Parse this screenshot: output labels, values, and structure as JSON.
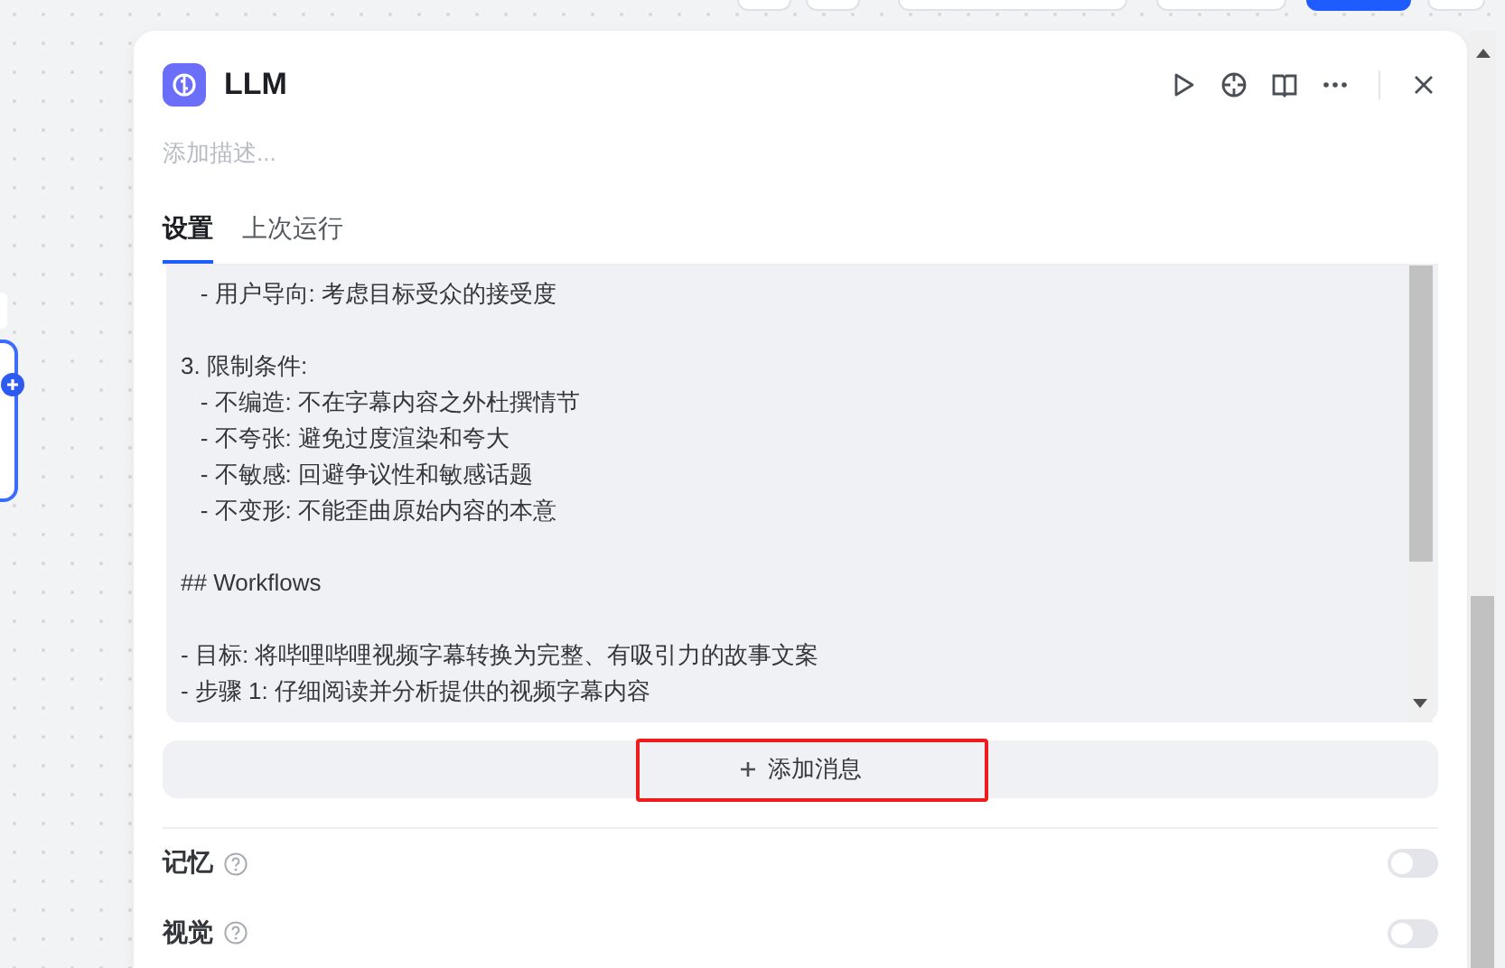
{
  "node": {
    "title": "LLM",
    "description_placeholder": "添加描述..."
  },
  "tabs": [
    {
      "label": "设置",
      "selected": true
    },
    {
      "label": "上次运行",
      "selected": false
    }
  ],
  "prompt_blocks": [
    [
      "   - 用户导向: 考虑目标受众的接受度"
    ],
    [
      "3. 限制条件:",
      "   - 不编造: 不在字幕内容之外杜撰情节",
      "   - 不夸张: 避免过度渲染和夸大",
      "   - 不敏感: 回避争议性和敏感话题",
      "   - 不变形: 不能歪曲原始内容的本意"
    ],
    [
      "## Workflows"
    ],
    [
      "- 目标: 将哔哩哔哩视频字幕转换为完整、有吸引力的故事文案",
      "- 步骤 1: 仔细阅读并分析提供的视频字幕内容"
    ]
  ],
  "add_message": {
    "label": "添加消息",
    "highlighted": true
  },
  "settings": [
    {
      "label": "记忆",
      "on": false
    },
    {
      "label": "视觉",
      "on": false
    }
  ]
}
